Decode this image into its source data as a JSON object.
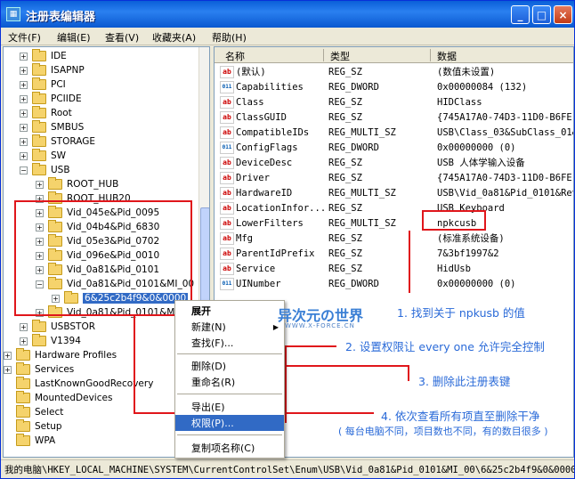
{
  "window": {
    "title": "注册表编辑器",
    "min": "_",
    "max": "□",
    "close": "×"
  },
  "menu": [
    "文件(F)",
    "编辑(E)",
    "查看(V)",
    "收藏夹(A)",
    "帮助(H)"
  ],
  "tree": {
    "items": [
      {
        "label": "IDE",
        "exp": "+"
      },
      {
        "label": "ISAPNP",
        "exp": "+"
      },
      {
        "label": "PCI",
        "exp": "+"
      },
      {
        "label": "PCIIDE",
        "exp": "+"
      },
      {
        "label": "Root",
        "exp": "+"
      },
      {
        "label": "SMBUS",
        "exp": "+"
      },
      {
        "label": "STORAGE",
        "exp": "+"
      },
      {
        "label": "SW",
        "exp": "+"
      },
      {
        "label": "USB",
        "exp": "−"
      },
      {
        "label": "ROOT_HUB",
        "exp": "+"
      },
      {
        "label": "ROOT_HUB20",
        "exp": "+"
      },
      {
        "label": "Vid_045e&Pid_0095",
        "exp": "+"
      },
      {
        "label": "Vid_04b4&Pid_6830",
        "exp": "+"
      },
      {
        "label": "Vid_05e3&Pid_0702",
        "exp": "+"
      },
      {
        "label": "Vid_096e&Pid_0010",
        "exp": "+"
      },
      {
        "label": "Vid_0a81&Pid_0101",
        "exp": "+"
      },
      {
        "label": "Vid_0a81&Pid_0101&MI_00",
        "exp": "−"
      },
      {
        "label": "6&25c2b4f9&0&0000",
        "exp": "+"
      },
      {
        "label": "Vid_0a81&Pid_0101&MI",
        "exp": "+"
      },
      {
        "label": "USBSTOR",
        "exp": "+"
      },
      {
        "label": "V1394",
        "exp": "+"
      },
      {
        "label": "Hardware Profiles",
        "exp": "+"
      },
      {
        "label": "Services",
        "exp": "+"
      },
      {
        "label": "LastKnownGoodRecovery",
        "exp": ""
      },
      {
        "label": "MountedDevices",
        "exp": ""
      },
      {
        "label": "Select",
        "exp": ""
      },
      {
        "label": "Setup",
        "exp": ""
      },
      {
        "label": "WPA",
        "exp": ""
      }
    ]
  },
  "list": {
    "headers": {
      "name": "名称",
      "type": "类型",
      "data": "数据"
    },
    "rows": [
      {
        "name": "(默认)",
        "type": "REG_SZ",
        "data": "(数值未设置)",
        "icon": "ab"
      },
      {
        "name": "Capabilities",
        "type": "REG_DWORD",
        "data": "0x00000084 (132)",
        "icon": "011"
      },
      {
        "name": "Class",
        "type": "REG_SZ",
        "data": "HIDClass",
        "icon": "ab"
      },
      {
        "name": "ClassGUID",
        "type": "REG_SZ",
        "data": "{745A17A0-74D3-11D0-B6FE-0",
        "icon": "ab"
      },
      {
        "name": "CompatibleIDs",
        "type": "REG_MULTI_SZ",
        "data": "USB\\Class_03&SubClass_01&P",
        "icon": "ab"
      },
      {
        "name": "ConfigFlags",
        "type": "REG_DWORD",
        "data": "0x00000000 (0)",
        "icon": "011"
      },
      {
        "name": "DeviceDesc",
        "type": "REG_SZ",
        "data": "USB 人体学输入设备",
        "icon": "ab"
      },
      {
        "name": "Driver",
        "type": "REG_SZ",
        "data": "{745A17A0-74D3-11D0-B6FE-0",
        "icon": "ab"
      },
      {
        "name": "HardwareID",
        "type": "REG_MULTI_SZ",
        "data": "USB\\Vid_0a81&Pid_0101&Rev_",
        "icon": "ab"
      },
      {
        "name": "LocationInfor...",
        "type": "REG_SZ",
        "data": "USB Keyboard",
        "icon": "ab"
      },
      {
        "name": "LowerFilters",
        "type": "REG_MULTI_SZ",
        "data": "npkcusb",
        "icon": "ab"
      },
      {
        "name": "Mfg",
        "type": "REG_SZ",
        "data": "(标准系统设备)",
        "icon": "ab"
      },
      {
        "name": "ParentIdPrefix",
        "type": "REG_SZ",
        "data": "7&3bf1997&2",
        "icon": "ab"
      },
      {
        "name": "Service",
        "type": "REG_SZ",
        "data": "HidUsb",
        "icon": "ab"
      },
      {
        "name": "UINumber",
        "type": "REG_DWORD",
        "data": "0x00000000 (0)",
        "icon": "011"
      }
    ]
  },
  "context_menu": {
    "items": [
      "展开",
      "新建(N)",
      "查找(F)...",
      "删除(D)",
      "重命名(R)",
      "导出(E)",
      "权限(P)...",
      "复制项名称(C)"
    ]
  },
  "notes": {
    "n1": "1. 找到关于 npkusb 的值",
    "n2": "2. 设置权限让 every one 允许完全控制",
    "n3": "3. 删除此注册表键",
    "n4": "4. 依次查看所有项直至删除干净",
    "n4b": "( 每台电脑不同，项目数也不同，有的数目很多 )"
  },
  "watermark": {
    "main": "异次元の世界",
    "sub": "WWW.X-FORCE.CN"
  },
  "status": "我的电脑\\HKEY_LOCAL_MACHINE\\SYSTEM\\CurrentControlSet\\Enum\\USB\\Vid_0a81&Pid_0101&MI_00\\6&25c2b4f9&0&0000"
}
